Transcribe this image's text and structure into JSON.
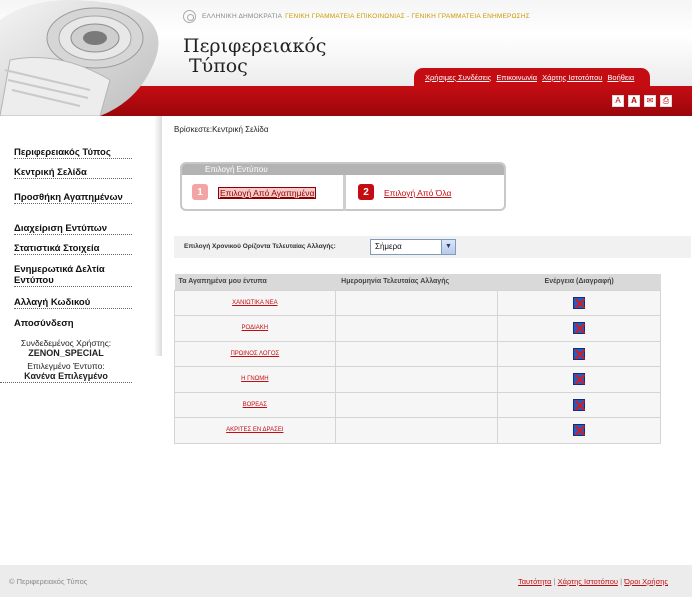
{
  "header": {
    "gov_text": "ΕΛΛΗΝΙΚΗ ΔΗΜΟΚΡΑΤΙΑ",
    "secretariat_text": "ΓΕΝΙΚΗ ΓΡΑΜΜΑΤΕΙΑ ΕΠΙΚΟΙΝΩΝΙΑΣ - ΓΕΝΙΚΗ ΓΡΑΜΜΑΤΕΙΑ ΕΝΗΜΕΡΩΣΗΣ",
    "title_line1": "Περιφερειακός",
    "title_line2": "Τύπος",
    "nav": [
      "Χρήσιμες Συνδέσεις",
      "Επικοινωνία",
      "Χάρτης Ιστοτόπου",
      "Βοήθεια"
    ],
    "icons": [
      "font-decrease-icon",
      "font-increase-icon",
      "email-icon",
      "print-icon"
    ]
  },
  "sidebar": {
    "items": [
      "Περιφερειακός Τύπος",
      "Κεντρική Σελίδα",
      "Προσθήκη Αγαπημένων",
      "Διαχείριση Εντύπων",
      "Στατιστικά Στοιχεία",
      "Ενημερωτικά Δελτία Εντύπου",
      "Αλλαγή Κωδικού",
      "Αποσύνδεση"
    ],
    "user_label": "Συνδεδεμένος Χρήστης:",
    "user_name": "ZENON_SPECIAL",
    "selected_label": "Επιλεγμένο Έντυπο:",
    "selected_value": "Κανένα Επιλεγμένο"
  },
  "breadcrumb": {
    "prefix": "Βρίσκεστε:",
    "current": "Κεντρική Σελίδα"
  },
  "picker": {
    "title": "Επιλογή Εντύπου",
    "option1_num": "1",
    "option1_label": "Επιλογή Από Αγαπημένα",
    "option2_num": "2",
    "option2_label": "Επιλογή Από Όλα"
  },
  "filter": {
    "label": "Επιλογή Χρονικού Ορίζοντα Τελευταίας Αλλαγής:",
    "selected": "Σήμερα"
  },
  "table": {
    "headers": [
      "Τα Αγαπημένα μου έντυπα",
      "Ημερομηνία Τελευταίας Αλλαγής",
      "Ενέργεια (Διαγραφή)"
    ],
    "rows": [
      {
        "name": "ΧΑΝΙΩΤΙΚΑ ΝΕΑ",
        "date": ""
      },
      {
        "name": "ΡΟΔΙΑΚΗ",
        "date": ""
      },
      {
        "name": "ΠΡΩΙΝΟΣ ΛΟΓΟΣ",
        "date": ""
      },
      {
        "name": "Η ΓΝΩΜΗ",
        "date": ""
      },
      {
        "name": "ΒΟΡΕΑΣ",
        "date": ""
      },
      {
        "name": "ΑΚΡΙΤΕΣ ΕΝ ΔΡΑΣΕΙ",
        "date": ""
      }
    ],
    "delete_icon": "delete-icon"
  },
  "footer": {
    "copyright": "© Περιφερειακός Τύπος",
    "links": [
      "Ταυτότητα",
      "Χάρτης Ιστοτόπου",
      "Όροι Χρήσης"
    ],
    "separator": "|"
  },
  "colors": {
    "brand_red": "#c40d13",
    "gold": "#c79a00",
    "footer_bg": "#ececec"
  }
}
